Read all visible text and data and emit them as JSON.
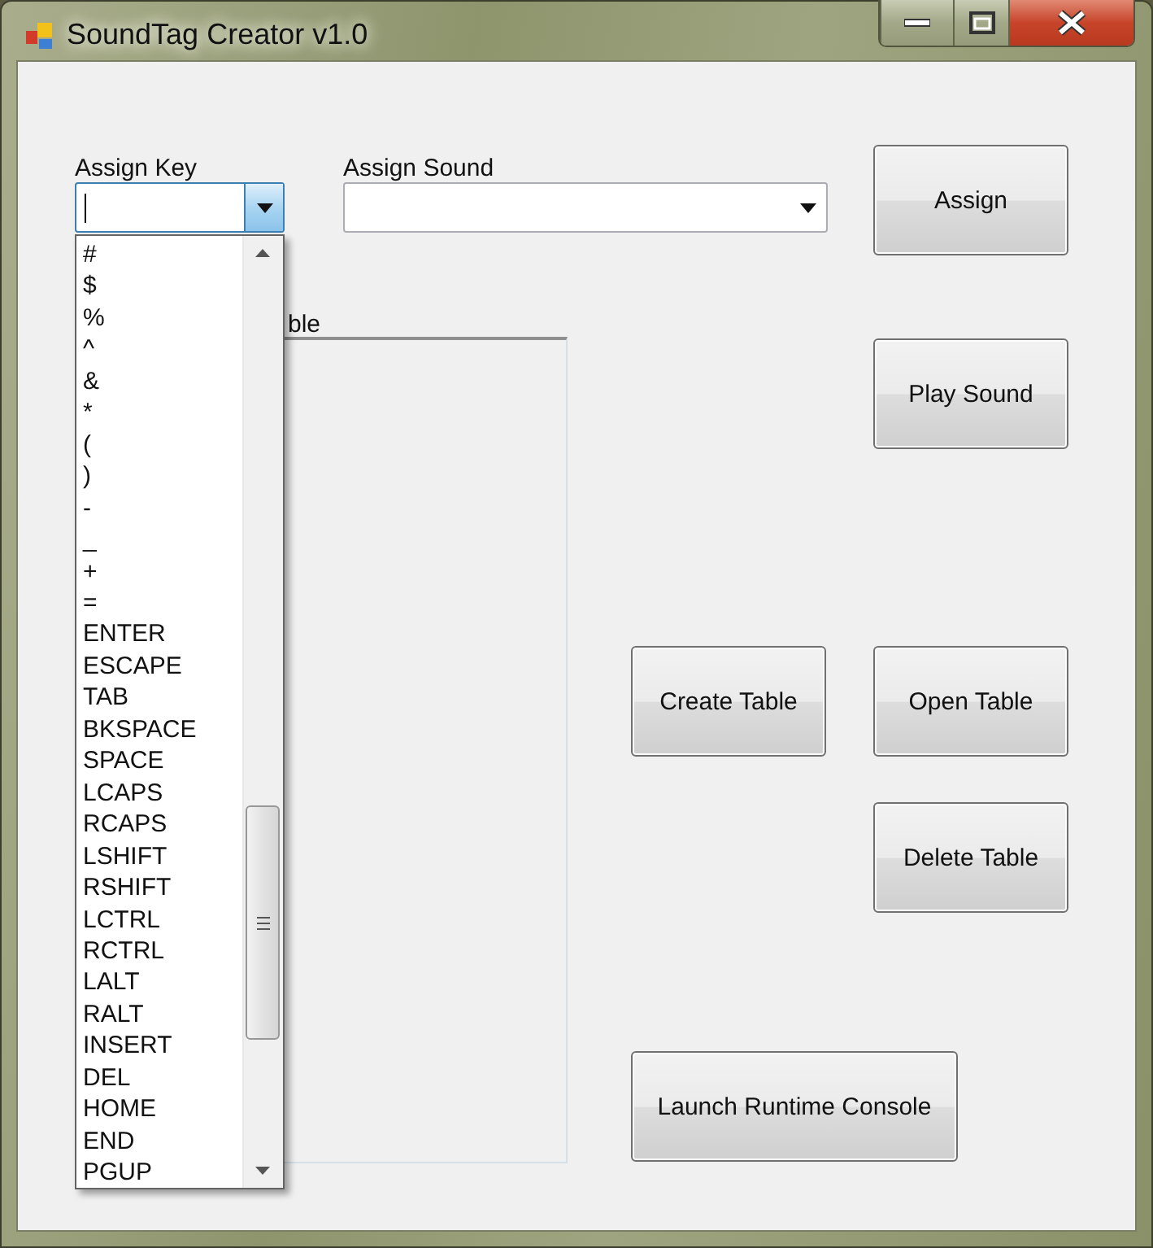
{
  "window": {
    "title": "SoundTag Creator v1.0"
  },
  "assign_key": {
    "label": "Assign Key",
    "expanded": true,
    "options": [
      "#",
      "$",
      "%",
      "^",
      "&",
      "*",
      "(",
      ")",
      "-",
      "_",
      "+",
      "=",
      "ENTER",
      "ESCAPE",
      "TAB",
      "BKSPACE",
      "SPACE",
      "LCAPS",
      "RCAPS",
      "LSHIFT",
      "RSHIFT",
      "LCTRL",
      "RCTRL",
      "LALT",
      "RALT",
      "INSERT",
      "DEL",
      "HOME",
      "END",
      "PGUP"
    ]
  },
  "assign_sound": {
    "label": "Assign Sound"
  },
  "assign_button": {
    "label": "Assign"
  },
  "table_group": {
    "title": "ble"
  },
  "play_button": {
    "label": "Play Sound"
  },
  "create_button": {
    "label": "Create Table"
  },
  "open_button": {
    "label": "Open Table"
  },
  "delete_button": {
    "label": "Delete Table"
  },
  "console_button": {
    "label": "Launch Runtime Console"
  }
}
